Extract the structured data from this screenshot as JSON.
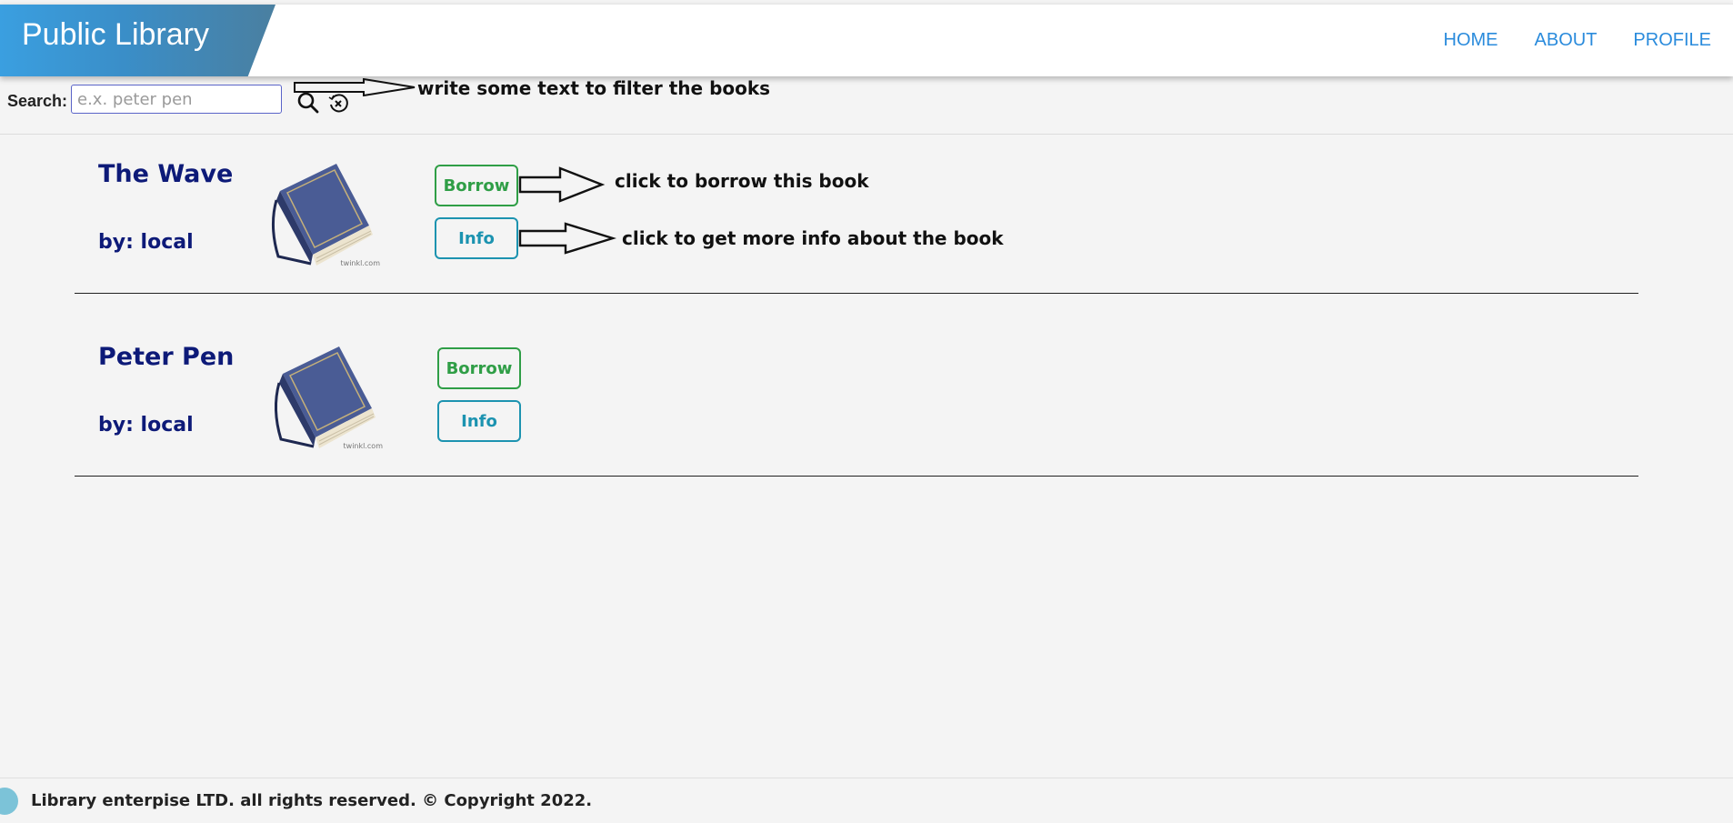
{
  "header": {
    "brand_title": "Public Library",
    "nav": [
      "HOME",
      "ABOUT",
      "PROFILE"
    ]
  },
  "search": {
    "label": "Search:",
    "placeholder": "e.x. peter pen",
    "value": "",
    "annotation": "write some text to filter the books"
  },
  "books": [
    {
      "title": "The Wave",
      "author": "by: local",
      "cover_credit": "twinkl.com",
      "borrow_label": "Borrow",
      "info_label": "Info"
    },
    {
      "title": "Peter Pen",
      "author": "by: local",
      "cover_credit": "twinkl.com",
      "borrow_label": "Borrow",
      "info_label": "Info"
    }
  ],
  "annotations": {
    "borrow": "click to borrow this book",
    "info": "click to get more info about the book"
  },
  "footer": {
    "text": "Library enterpise LTD. all rights reserved. © Copyright 2022."
  },
  "colors": {
    "title": "#0d1a78",
    "borrow": "#2f9e46",
    "info": "#1c93b0",
    "nav": "#2a8bdc",
    "brand": "#3a9fe0"
  }
}
